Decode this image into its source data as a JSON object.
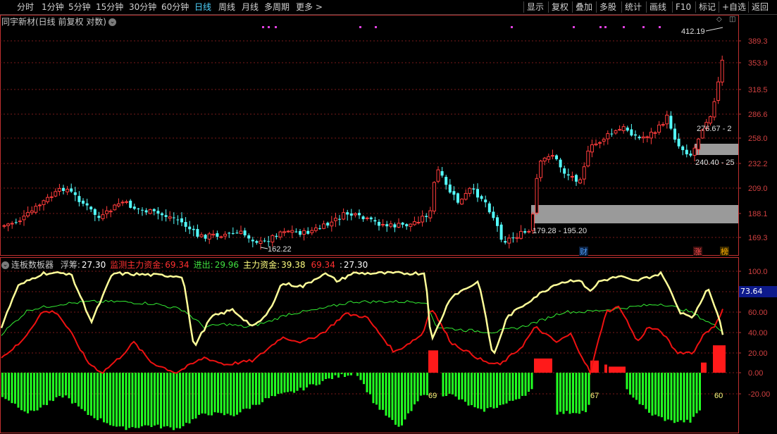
{
  "toolbar": {
    "left": [
      "分时",
      "1分钟",
      "5分钟",
      "15分钟",
      "30分钟",
      "60分钟",
      "日线",
      "周线",
      "月线",
      "多周期",
      "更多 >"
    ],
    "active_index": 6,
    "right": [
      "显示",
      "复权",
      "叠加",
      "多股",
      "统计",
      "画线",
      "F10",
      "标记",
      "+自选",
      "返回"
    ]
  },
  "main": {
    "title": "同宇新材(日线 前复权 对数)",
    "y_ticks": [
      "389.3",
      "353.9",
      "318.5",
      "286.6",
      "258.0",
      "232.2",
      "209.0",
      "188.1",
      "169.3"
    ],
    "high_label": "412.19",
    "low_label": "162.22",
    "gap_labels": [
      "276.67 - 2",
      "240.40 - 25",
      "179.28 - 195.20"
    ],
    "markers": [
      "财",
      "涨",
      "榜"
    ]
  },
  "indicator": {
    "name": "连板数板器",
    "items": [
      {
        "label": "浮筹:",
        "value": "27.30",
        "color": "#ffffff"
      },
      {
        "label": "监测主力资金:",
        "value": "69.34",
        "color": "#ff3030"
      },
      {
        "label": "进出:",
        "value": "29.96",
        "color": "#40e040"
      },
      {
        "label": "主力资金:",
        "value": "39.38",
        "color": "#ffff80"
      },
      {
        "label": "",
        "value": "69.34",
        "color": "#ff3030"
      },
      {
        "label": ":",
        "value": "27.30",
        "color": "#ffffff"
      }
    ],
    "y_ticks": [
      "100.0",
      "80.00",
      "60.00",
      "40.00",
      "20.00",
      "0.00",
      "-20.00"
    ],
    "current_value": "73.64",
    "bar_labels": [
      "69",
      "67",
      "60"
    ]
  },
  "colors": {
    "up": "#ff3c3c",
    "down": "#54ffff",
    "grid": "#7a1a1a",
    "axis": "#c03030",
    "yellow": "#ffff99",
    "green": "#33ee33",
    "red": "#ee1111",
    "bar_green": "#22ff22"
  }
}
